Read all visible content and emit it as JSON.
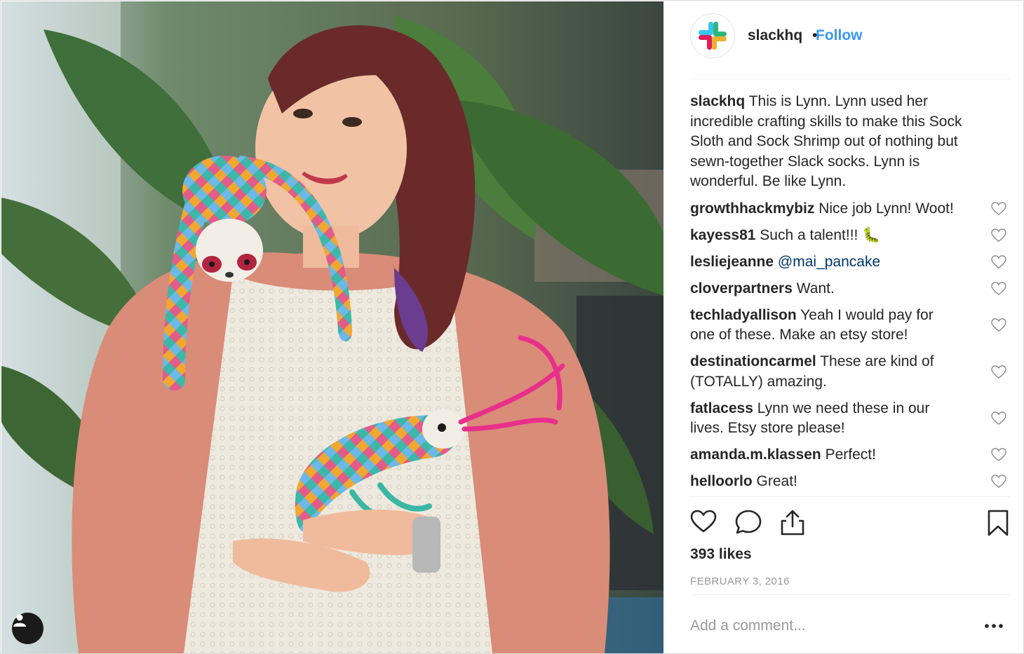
{
  "post": {
    "account": "slackhq",
    "follow_label": "Follow",
    "separator": "•"
  },
  "caption": {
    "username": "slackhq",
    "text": "This is Lynn. Lynn used her incredible crafting skills to make this Sock Sloth and Sock Shrimp out of nothing but sewn-together Slack socks. Lynn is wonderful. Be like Lynn."
  },
  "comments": [
    {
      "username": "growthhackmybiz",
      "text": "Nice job Lynn! Woot!"
    },
    {
      "username": "kayess81",
      "text": "Such a talent!!! 🐛"
    },
    {
      "username": "lesliejeanne",
      "mention": "@mai_pancake",
      "text": ""
    },
    {
      "username": "cloverpartners",
      "text": "Want."
    },
    {
      "username": "techladyallison",
      "text": "Yeah I would pay for one of these. Make an etsy store!"
    },
    {
      "username": "destinationcarmel",
      "text": "These are kind of (TOTALLY) amazing."
    },
    {
      "username": "fatlacess",
      "text": "Lynn we need these in our lives. Etsy store please!"
    },
    {
      "username": "amanda.m.klassen",
      "text": "Perfect!"
    },
    {
      "username": "helloorlo",
      "text": "Great!"
    }
  ],
  "stats": {
    "likes": "393 likes",
    "date": "FEBRUARY 3, 2016"
  },
  "add_comment": {
    "placeholder": "Add a comment..."
  },
  "icons": {
    "avatar": "slack-logo-icon",
    "like": "heart-icon",
    "comment": "speech-bubble-icon",
    "share": "share-icon",
    "save": "bookmark-icon",
    "more": "more-dots-icon",
    "user_tag": "person-icon"
  },
  "colors": {
    "link_blue": "#3897f0",
    "mention_blue": "#003569",
    "muted_gray": "#999999",
    "text": "#262626"
  }
}
